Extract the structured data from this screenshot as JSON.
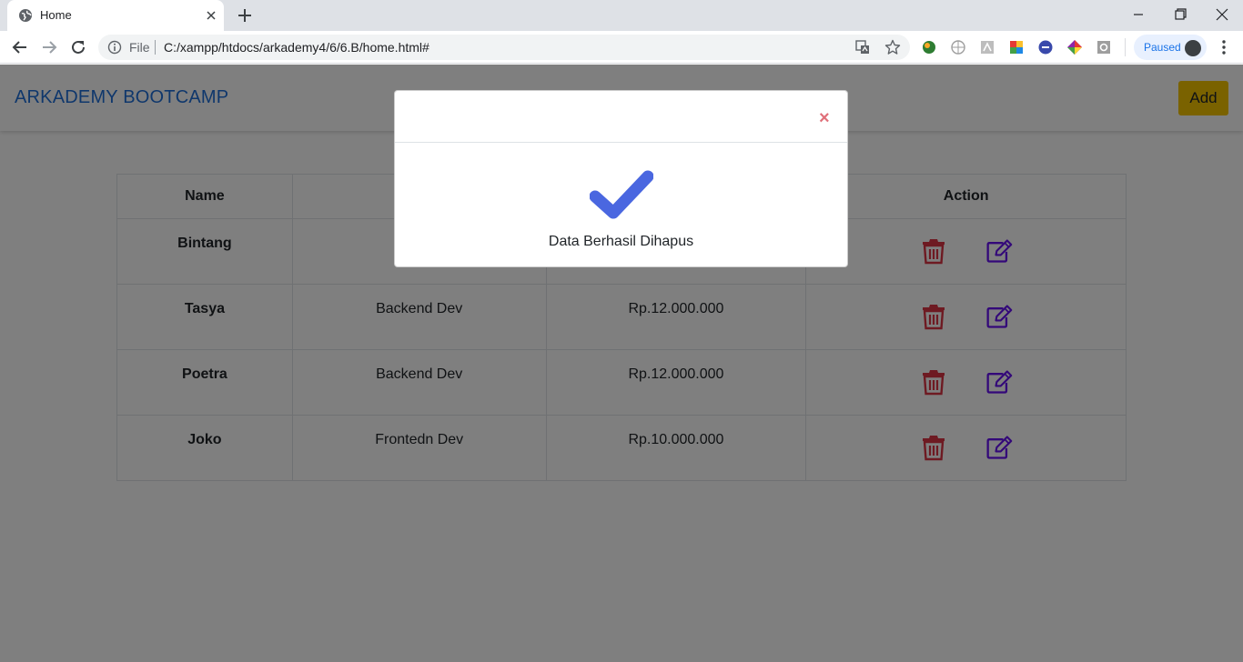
{
  "browser": {
    "tab_title": "Home",
    "omnibox": {
      "scheme_label": "File",
      "url": "C:/xampp/htdocs/arkademy4/6/6.B/home.html#"
    },
    "profile_status": "Paused"
  },
  "navbar": {
    "brand": "ARKADEMY BOOTCAMP",
    "add_label": "Add"
  },
  "table": {
    "headers": [
      "Name",
      "",
      "",
      "Action"
    ],
    "rows": [
      {
        "name": "Bintang",
        "job": "Ba",
        "salary": ""
      },
      {
        "name": "Tasya",
        "job": "Backend Dev",
        "salary": "Rp.12.000.000"
      },
      {
        "name": "Poetra",
        "job": "Backend Dev",
        "salary": "Rp.12.000.000"
      },
      {
        "name": "Joko",
        "job": "Frontedn Dev",
        "salary": "Rp.10.000.000"
      }
    ]
  },
  "modal": {
    "close_symbol": "×",
    "message": "Data Berhasil Dihapus"
  },
  "colors": {
    "brand": "#1e6fd9",
    "add_button": "#f5c400",
    "delete_icon": "#dc3545",
    "edit_icon": "#6610f2",
    "check_icon": "#4a67e0",
    "close_icon": "#e0707a"
  },
  "icons": {
    "tab_favicon": "globe-icon",
    "delete": "trash-icon",
    "edit": "edit-icon",
    "modal": "check-icon"
  }
}
